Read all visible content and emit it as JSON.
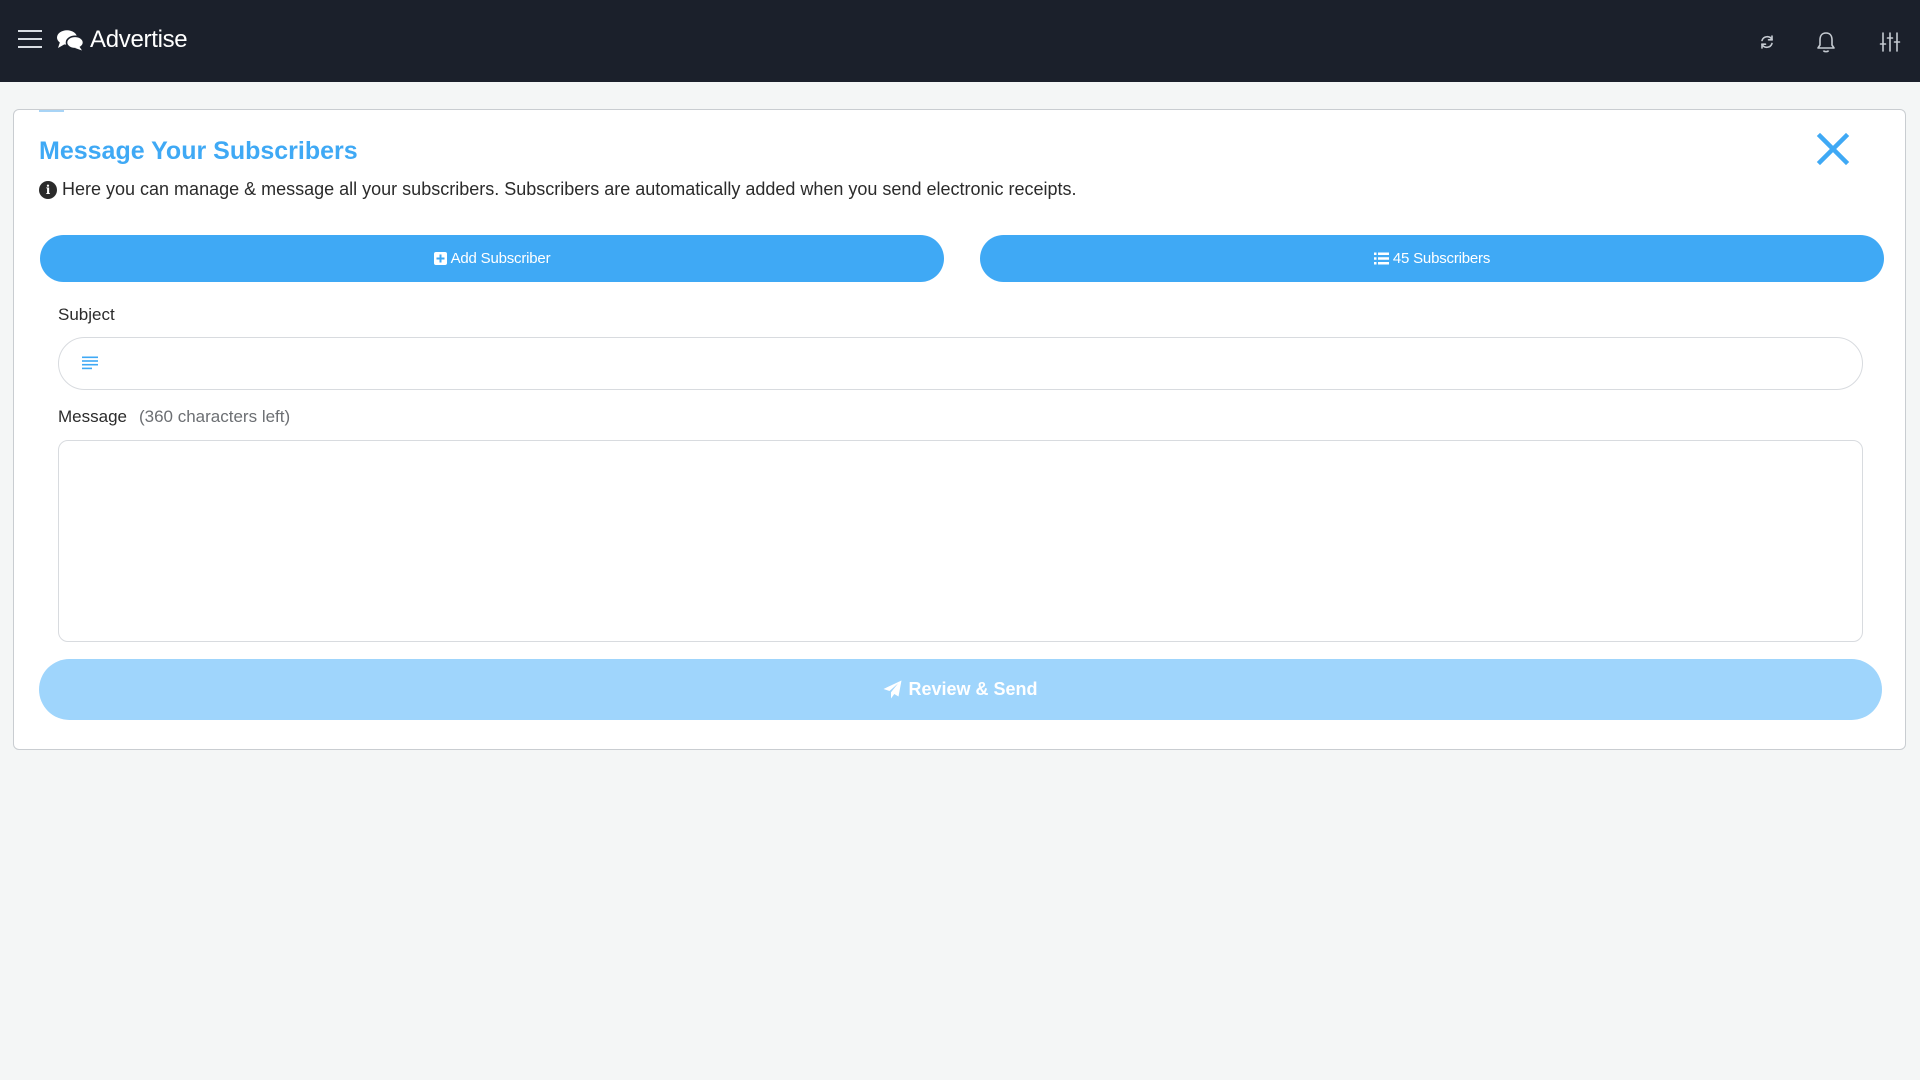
{
  "topbar": {
    "title": "Advertise",
    "brand_icon": "comments-icon",
    "menu_icon": "hamburger-menu-icon",
    "icons": [
      "refresh-icon",
      "bell-icon",
      "sliders-icon"
    ]
  },
  "card": {
    "title": "Message Your Subscribers",
    "info_text": "Here you can manage & message all your subscribers. Subscribers are automatically added when you send electronic receipts.",
    "add_subscriber_label": "Add Subscriber",
    "subscribers_label": "45 Subscribers"
  },
  "form": {
    "subject_label": "Subject",
    "subject_value": "",
    "message_label": "Message",
    "message_hint": "(360 characters left)",
    "message_value": "",
    "send_label": "Review & Send"
  },
  "colors": {
    "topbar_bg": "#1b202b",
    "accent": "#3fa9f5",
    "accent_disabled": "#9fd5fc",
    "page_bg": "#f4f6f6"
  }
}
